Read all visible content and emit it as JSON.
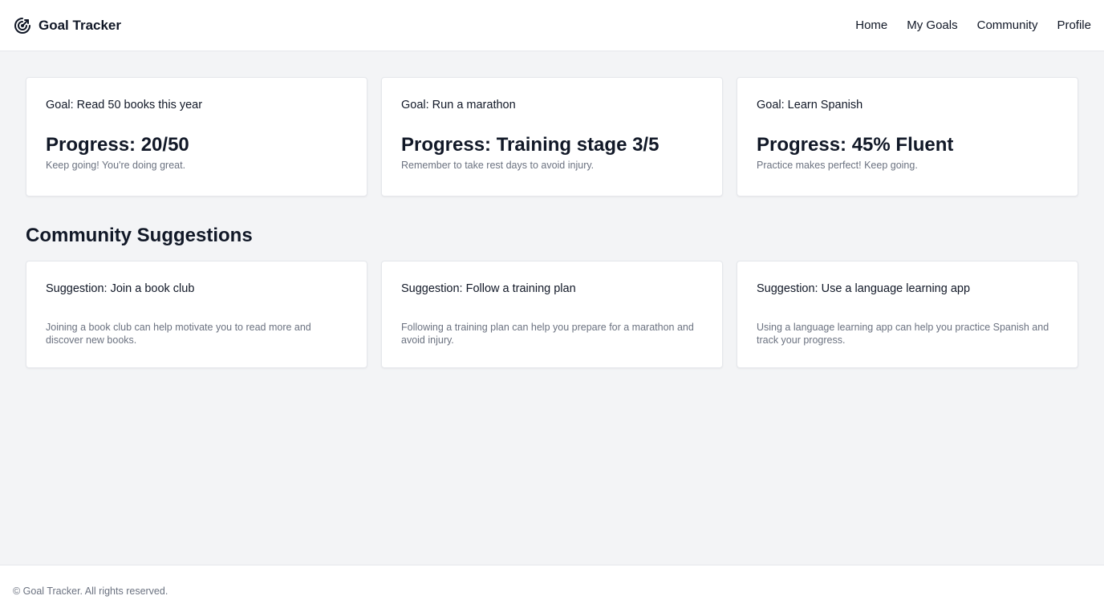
{
  "header": {
    "logo_icon": "target-arrow-icon",
    "app_name": "Goal Tracker",
    "nav": [
      {
        "label": "Home"
      },
      {
        "label": "My Goals"
      },
      {
        "label": "Community"
      },
      {
        "label": "Profile"
      }
    ]
  },
  "goals": [
    {
      "title": "Goal: Read 50 books this year",
      "progress": "Progress: 20/50",
      "note": "Keep going! You're doing great."
    },
    {
      "title": "Goal: Run a marathon",
      "progress": "Progress: Training stage 3/5",
      "note": "Remember to take rest days to avoid injury."
    },
    {
      "title": "Goal: Learn Spanish",
      "progress": "Progress: 45% Fluent",
      "note": "Practice makes perfect! Keep going."
    }
  ],
  "community": {
    "title": "Community Suggestions",
    "suggestions": [
      {
        "title": "Suggestion: Join a book club",
        "description": "Joining a book club can help motivate you to read more and discover new books."
      },
      {
        "title": "Suggestion: Follow a training plan",
        "description": "Following a training plan can help you prepare for a marathon and avoid injury."
      },
      {
        "title": "Suggestion: Use a language learning app",
        "description": "Using a language learning app can help you practice Spanish and track your progress."
      }
    ]
  },
  "footer": {
    "copyright": "© Goal Tracker. All rights reserved."
  },
  "colors": {
    "background": "#f3f4f6",
    "surface": "#ffffff",
    "text": "#111827",
    "muted": "#6b7280",
    "border": "#e5e7eb"
  }
}
